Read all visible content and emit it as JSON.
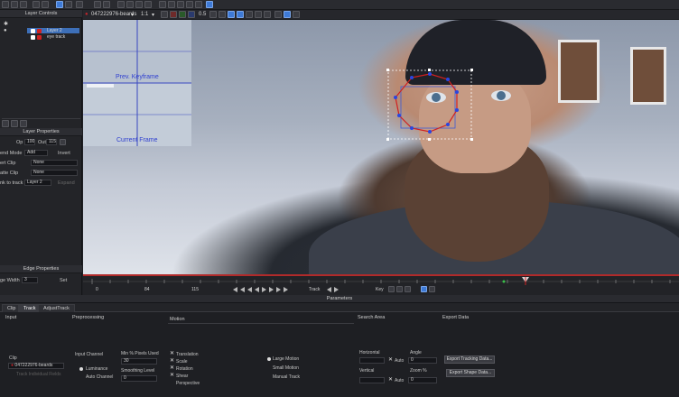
{
  "toolbar": {
    "clip_name": "047222976-beards",
    "zoom": "1:1",
    "opacity": "0.5",
    "color_red": "#c0262c"
  },
  "layer_controls": {
    "title": "Layer Controls",
    "layers": [
      {
        "name": "Layer 2",
        "selected": true
      },
      {
        "name": "eye track",
        "selected": false
      }
    ]
  },
  "layer_properties": {
    "title": "Layer Properties",
    "op_label": "Op",
    "op_value": "100",
    "out_label": "Out",
    "out_value": "115",
    "blend_label": "end Mode",
    "blend_value": "Add",
    "invert_label": "Invert",
    "insert_clip_label": "ert Clip",
    "insert_clip_value": "None",
    "matte_clip_label": "atte Clip",
    "matte_clip_value": "None",
    "link_label": "nk to track",
    "link_value": "Layer 2",
    "expand_label": "Expand"
  },
  "edge_properties": {
    "title": "Edge Properties",
    "width_label": "ge Width",
    "width_value": "3",
    "set_label": "Set"
  },
  "overlay": {
    "prev_keyframe": "Prev. Keyframe",
    "current_frame": "Current Frame"
  },
  "timeline": {
    "start": "0",
    "current": "84",
    "end": "115",
    "track_label": "Track",
    "key_label": "Key"
  },
  "parameters": {
    "title": "Parameters",
    "tabs": [
      "Clip",
      "Track",
      "AdjustTrack"
    ],
    "active_tab": "Track"
  },
  "input": {
    "title": "Input",
    "clip_label": "Clip",
    "clip_value": "047222976-beards",
    "clip_hint": "Track Individual Fields"
  },
  "preprocessing": {
    "title": "Preprocessing",
    "channel_label": "Input Channel",
    "luminance": "Luminance",
    "auto_channel": "Auto Channel",
    "min_pixels_label": "Min % Pixels Used",
    "min_pixels_value": "30",
    "smoothing_label": "Smoothing Level",
    "smoothing_value": "0"
  },
  "motion": {
    "title": "Motion",
    "options": [
      "Translation",
      "Scale",
      "Rotation",
      "Shear",
      "Perspective"
    ],
    "checked": [
      true,
      true,
      true,
      true,
      false
    ],
    "radio": [
      "Large Motion",
      "Small Motion",
      "Manual Track"
    ],
    "radio_selected": 0
  },
  "search_area": {
    "title": "Search Area",
    "horizontal_label": "Horizontal",
    "vertical_label": "Vertical",
    "angle_label": "Angle",
    "angle_value": "0",
    "zoom_label": "Zoom %",
    "zoom_value": "0",
    "auto_label": "Auto"
  },
  "export_data": {
    "title": "Export Data",
    "export_tracking": "Export Tracking Data...",
    "export_shape": "Export Shape Data..."
  }
}
